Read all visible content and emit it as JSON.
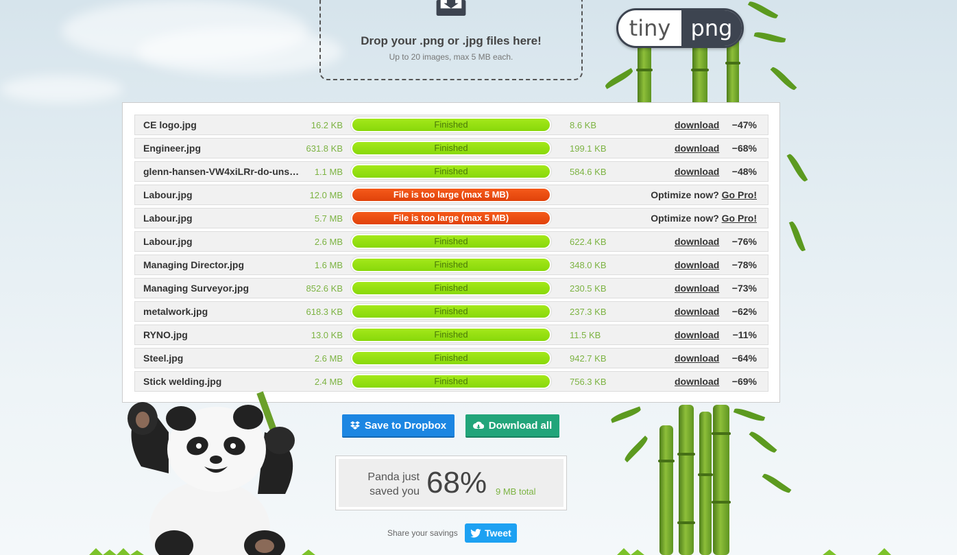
{
  "dropzone": {
    "title": "Drop your .png or .jpg files here!",
    "subtitle": "Up to 20 images, max 5 MB each."
  },
  "logo": {
    "left": "tiny",
    "right": "png"
  },
  "files": [
    {
      "name": "CE logo.jpg",
      "original": "16.2 KB",
      "status": "Finished",
      "state": "ok",
      "compressed": "8.6 KB",
      "action": "download",
      "savings": "−47%"
    },
    {
      "name": "Engineer.jpg",
      "original": "631.8 KB",
      "status": "Finished",
      "state": "ok",
      "compressed": "199.1 KB",
      "action": "download",
      "savings": "−68%"
    },
    {
      "name": "glenn-hansen-VW4xiLRr-do-unsplash.jpg",
      "original": "1.1 MB",
      "status": "Finished",
      "state": "ok",
      "compressed": "584.6 KB",
      "action": "download",
      "savings": "−48%"
    },
    {
      "name": "Labour.jpg",
      "original": "12.0 MB",
      "status": "File is too large (max 5 MB)",
      "state": "err",
      "optimize": "Optimize now?",
      "gopro": "Go Pro!"
    },
    {
      "name": "Labour.jpg",
      "original": "5.7 MB",
      "status": "File is too large (max 5 MB)",
      "state": "err",
      "optimize": "Optimize now?",
      "gopro": "Go Pro!"
    },
    {
      "name": "Labour.jpg",
      "original": "2.6 MB",
      "status": "Finished",
      "state": "ok",
      "compressed": "622.4 KB",
      "action": "download",
      "savings": "−76%"
    },
    {
      "name": "Managing Director.jpg",
      "original": "1.6 MB",
      "status": "Finished",
      "state": "ok",
      "compressed": "348.0 KB",
      "action": "download",
      "savings": "−78%"
    },
    {
      "name": "Managing Surveyor.jpg",
      "original": "852.6 KB",
      "status": "Finished",
      "state": "ok",
      "compressed": "230.5 KB",
      "action": "download",
      "savings": "−73%"
    },
    {
      "name": "metalwork.jpg",
      "original": "618.3 KB",
      "status": "Finished",
      "state": "ok",
      "compressed": "237.3 KB",
      "action": "download",
      "savings": "−62%"
    },
    {
      "name": "RYNO.jpg",
      "original": "13.0 KB",
      "status": "Finished",
      "state": "ok",
      "compressed": "11.5 KB",
      "action": "download",
      "savings": "−11%"
    },
    {
      "name": "Steel.jpg",
      "original": "2.6 MB",
      "status": "Finished",
      "state": "ok",
      "compressed": "942.7 KB",
      "action": "download",
      "savings": "−64%"
    },
    {
      "name": "Stick welding.jpg",
      "original": "2.4 MB",
      "status": "Finished",
      "state": "ok",
      "compressed": "756.3 KB",
      "action": "download",
      "savings": "−69%"
    }
  ],
  "buttons": {
    "dropbox": "Save to Dropbox",
    "download_all": "Download all"
  },
  "savings": {
    "label": "Panda just saved you",
    "percent": "68%",
    "total": "9 MB total"
  },
  "share": {
    "label": "Share your savings",
    "tweet": "Tweet"
  },
  "colors": {
    "ok": "#88d80a",
    "error": "#e0420a",
    "dropbox": "#1c86e2",
    "download_all": "#22a57a",
    "twitter": "#1da1f2"
  },
  "icons": [
    "upload-tray-icon",
    "dropbox-icon",
    "cloud-download-icon",
    "twitter-icon"
  ]
}
